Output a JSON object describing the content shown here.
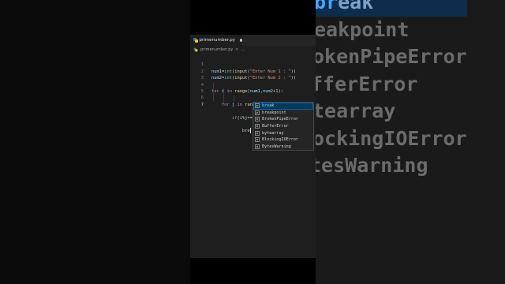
{
  "editor": {
    "tab": {
      "title": "primenumber.py",
      "icon": "python-icon",
      "modified": true
    },
    "breadcrumb": {
      "file": "primenumber.py",
      "separator": ">",
      "more": "..."
    },
    "lines": [
      {
        "number": "1",
        "code": "num1=int(input(\"Enter Num 1 : \"))"
      },
      {
        "number": "2",
        "code": "num2=int(input(\"Enter Num 2 : \"))"
      },
      {
        "number": "3",
        "code": ""
      },
      {
        "number": "4",
        "code": "for i in range(num1,num2+1):"
      },
      {
        "number": "5",
        "code": "    for j in range(2,i):"
      },
      {
        "number": "6",
        "code": "        if(i%j==0):"
      },
      {
        "number": "7",
        "code": "            bre"
      }
    ]
  },
  "suggestions": {
    "typed": "bre",
    "items": [
      {
        "label": "break",
        "icon": "keyword-icon",
        "selected": true
      },
      {
        "label": "breakpoint",
        "icon": "keyword-icon",
        "selected": false
      },
      {
        "label": "BrokenPipeError",
        "icon": "class-icon",
        "selected": false
      },
      {
        "label": "BufferError",
        "icon": "class-icon",
        "selected": false
      },
      {
        "label": "bytearray",
        "icon": "class-icon",
        "selected": false
      },
      {
        "label": "BlockingIOError",
        "icon": "class-icon",
        "selected": false
      },
      {
        "label": "BytesWarning",
        "icon": "class-icon",
        "selected": false
      }
    ]
  },
  "zoom_panel": {
    "items": [
      "eak",
      "eakpoint",
      "okenPipeError",
      "fferError",
      "tearray",
      "ockingIOError",
      "tesWarning"
    ]
  },
  "colors": {
    "background": "#000000",
    "editor_bg": "#1e1e1e",
    "keyword": "#c586c0",
    "builtin": "#4ec9b0",
    "function": "#dcdcaa",
    "string": "#ce9178",
    "selection": "#04395e",
    "match_highlight": "#2aaaff"
  }
}
